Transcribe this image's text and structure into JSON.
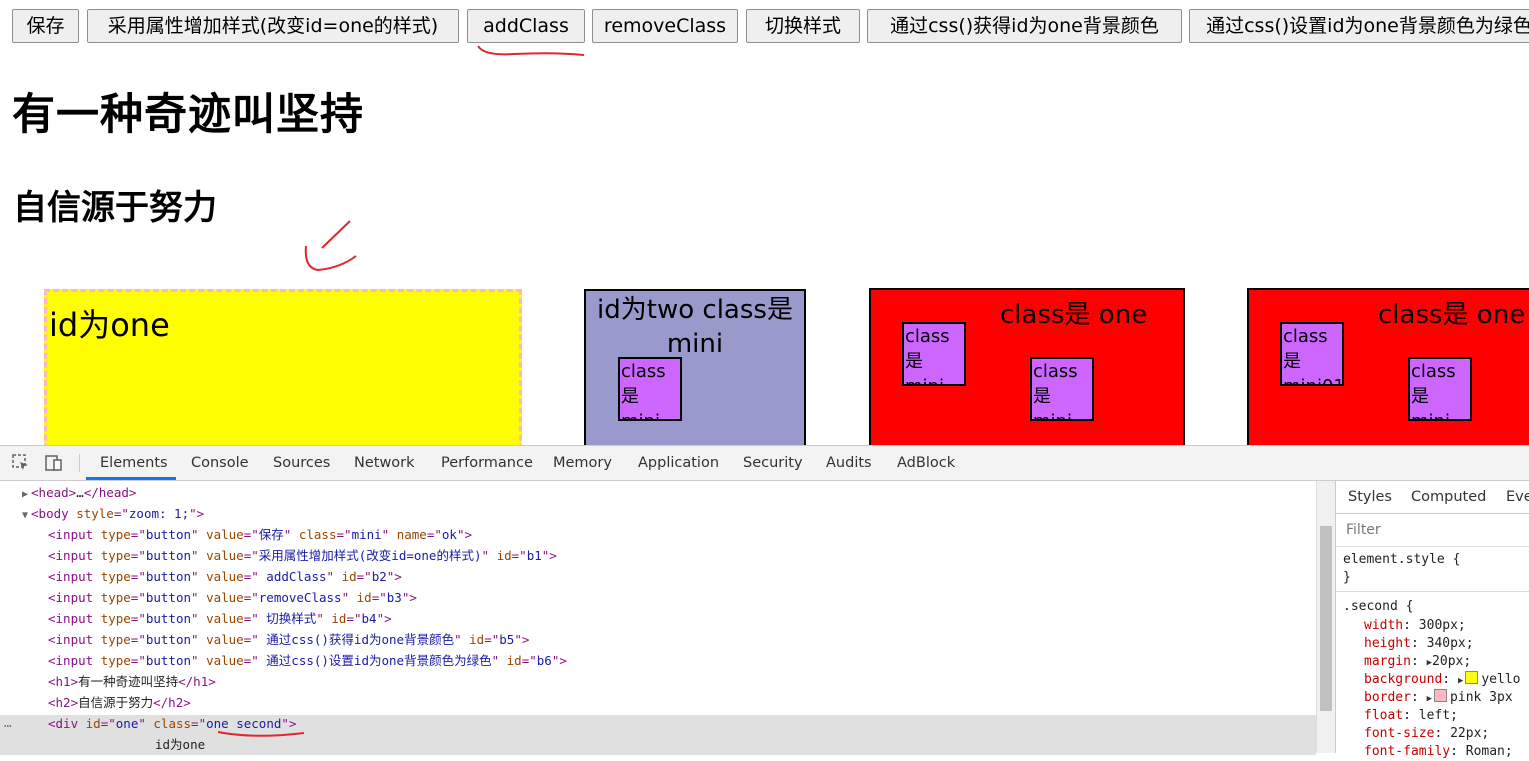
{
  "buttons": [
    {
      "label": "保存"
    },
    {
      "label": "采用属性增加样式(改变id=one的样式)"
    },
    {
      "label": "addClass"
    },
    {
      "label": "removeClass"
    },
    {
      "label": "切换样式"
    },
    {
      "label": "通过css()获得id为one背景颜色"
    },
    {
      "label": "通过css()设置id为one背景颜色为绿色"
    }
  ],
  "headings": {
    "h1": "有一种奇迹叫坚持",
    "h2": "自信源于努力"
  },
  "boxes": {
    "one_label": "id为one",
    "two_label": "id为two class是 mini",
    "two_inner": "class是 mini",
    "red1_label": "class是 one",
    "red1_mini_a": "class是 mini",
    "red1_mini_b": "class是 mini",
    "red2_label": "class是 one",
    "red2_mini_a": "class是 mini01",
    "red2_mini_b": "class是 mini"
  },
  "colors": {
    "yellow": "#ffff00",
    "pink": "#ffb6c1",
    "lavender": "#9999cc",
    "red": "#ff0000",
    "purple": "#cc66ff",
    "annotation": "#e0262f"
  },
  "devtools": {
    "tabs": [
      "Elements",
      "Console",
      "Sources",
      "Network",
      "Performance",
      "Memory",
      "Application",
      "Security",
      "Audits",
      "AdBlock"
    ],
    "active_tab": "Elements",
    "dom_lines": [
      {
        "parts": [
          [
            "tag",
            "<head>"
          ],
          [
            "txt",
            "…"
          ],
          [
            "tag",
            "</head>"
          ]
        ]
      },
      {
        "parts": [
          [
            "tag",
            "<body "
          ],
          [
            "attr",
            "style"
          ],
          [
            "tag",
            "=\""
          ],
          [
            "val",
            "zoom: 1;"
          ],
          [
            "tag",
            "\">"
          ]
        ]
      },
      {
        "parts": [
          [
            "tag",
            "<input "
          ],
          [
            "attr",
            "type"
          ],
          [
            "tag",
            "=\""
          ],
          [
            "val",
            "button"
          ],
          [
            "tag",
            "\" "
          ],
          [
            "attr",
            "value"
          ],
          [
            "tag",
            "=\""
          ],
          [
            "val",
            "保存"
          ],
          [
            "tag",
            "\" "
          ],
          [
            "attr",
            "class"
          ],
          [
            "tag",
            "=\""
          ],
          [
            "val",
            "mini"
          ],
          [
            "tag",
            "\" "
          ],
          [
            "attr",
            "name"
          ],
          [
            "tag",
            "=\""
          ],
          [
            "val",
            "ok"
          ],
          [
            "tag",
            "\">"
          ]
        ]
      },
      {
        "parts": [
          [
            "tag",
            "<input "
          ],
          [
            "attr",
            "type"
          ],
          [
            "tag",
            "=\""
          ],
          [
            "val",
            "button"
          ],
          [
            "tag",
            "\" "
          ],
          [
            "attr",
            "value"
          ],
          [
            "tag",
            "=\""
          ],
          [
            "val",
            "采用属性增加样式(改变id=one的样式)"
          ],
          [
            "tag",
            "\" "
          ],
          [
            "attr",
            "id"
          ],
          [
            "tag",
            "=\""
          ],
          [
            "val",
            "b1"
          ],
          [
            "tag",
            "\">"
          ]
        ]
      },
      {
        "parts": [
          [
            "tag",
            "<input "
          ],
          [
            "attr",
            "type"
          ],
          [
            "tag",
            "=\""
          ],
          [
            "val",
            "button"
          ],
          [
            "tag",
            "\" "
          ],
          [
            "attr",
            "value"
          ],
          [
            "tag",
            "=\""
          ],
          [
            "val",
            " addClass"
          ],
          [
            "tag",
            "\" "
          ],
          [
            "attr",
            "id"
          ],
          [
            "tag",
            "=\""
          ],
          [
            "val",
            "b2"
          ],
          [
            "tag",
            "\">"
          ]
        ]
      },
      {
        "parts": [
          [
            "tag",
            "<input "
          ],
          [
            "attr",
            "type"
          ],
          [
            "tag",
            "=\""
          ],
          [
            "val",
            "button"
          ],
          [
            "tag",
            "\" "
          ],
          [
            "attr",
            "value"
          ],
          [
            "tag",
            "=\""
          ],
          [
            "val",
            "removeClass"
          ],
          [
            "tag",
            "\" "
          ],
          [
            "attr",
            "id"
          ],
          [
            "tag",
            "=\""
          ],
          [
            "val",
            "b3"
          ],
          [
            "tag",
            "\">"
          ]
        ]
      },
      {
        "parts": [
          [
            "tag",
            "<input "
          ],
          [
            "attr",
            "type"
          ],
          [
            "tag",
            "=\""
          ],
          [
            "val",
            "button"
          ],
          [
            "tag",
            "\" "
          ],
          [
            "attr",
            "value"
          ],
          [
            "tag",
            "=\""
          ],
          [
            "val",
            " 切换样式"
          ],
          [
            "tag",
            "\" "
          ],
          [
            "attr",
            "id"
          ],
          [
            "tag",
            "=\""
          ],
          [
            "val",
            "b4"
          ],
          [
            "tag",
            "\">"
          ]
        ]
      },
      {
        "parts": [
          [
            "tag",
            "<input "
          ],
          [
            "attr",
            "type"
          ],
          [
            "tag",
            "=\""
          ],
          [
            "val",
            "button"
          ],
          [
            "tag",
            "\" "
          ],
          [
            "attr",
            "value"
          ],
          [
            "tag",
            "=\""
          ],
          [
            "val",
            " 通过css()获得id为one背景颜色"
          ],
          [
            "tag",
            "\" "
          ],
          [
            "attr",
            "id"
          ],
          [
            "tag",
            "=\""
          ],
          [
            "val",
            "b5"
          ],
          [
            "tag",
            "\">"
          ]
        ]
      },
      {
        "parts": [
          [
            "tag",
            "<input "
          ],
          [
            "attr",
            "type"
          ],
          [
            "tag",
            "=\""
          ],
          [
            "val",
            "button"
          ],
          [
            "tag",
            "\" "
          ],
          [
            "attr",
            "value"
          ],
          [
            "tag",
            "=\""
          ],
          [
            "val",
            " 通过css()设置id为one背景颜色为绿色"
          ],
          [
            "tag",
            "\" "
          ],
          [
            "attr",
            "id"
          ],
          [
            "tag",
            "=\""
          ],
          [
            "val",
            "b6"
          ],
          [
            "tag",
            "\">"
          ]
        ]
      },
      {
        "parts": [
          [
            "tag",
            "<h1>"
          ],
          [
            "txt",
            "有一种奇迹叫坚持"
          ],
          [
            "tag",
            "</h1>"
          ]
        ]
      },
      {
        "parts": [
          [
            "tag",
            "<h2>"
          ],
          [
            "txt",
            "自信源于努力"
          ],
          [
            "tag",
            "</h2>"
          ]
        ]
      },
      {
        "parts": [
          [
            "tag",
            "<div "
          ],
          [
            "attr",
            "id"
          ],
          [
            "tag",
            "=\""
          ],
          [
            "val",
            "one"
          ],
          [
            "tag",
            "\" "
          ],
          [
            "attr",
            "class"
          ],
          [
            "tag",
            "=\""
          ],
          [
            "val",
            "one second"
          ],
          [
            "tag",
            "\">"
          ]
        ]
      },
      {
        "parts": [
          [
            "txt",
            "id为one"
          ]
        ]
      }
    ],
    "ellipsis": "…",
    "styles_tabs": [
      "Styles",
      "Computed",
      "Eve"
    ],
    "filter_placeholder": "Filter",
    "element_style_open": "element.style {",
    "element_style_close": "}",
    "rule_selector": ".second {",
    "declarations": [
      {
        "prop": "width",
        "value": "300px;"
      },
      {
        "prop": "height",
        "value": "340px;"
      },
      {
        "prop": "margin",
        "value": "20px;"
      },
      {
        "prop": "background",
        "value": "yello"
      },
      {
        "prop": "border",
        "value": "pink 3px"
      },
      {
        "prop": "float",
        "value": "left;"
      },
      {
        "prop": "font-size",
        "value": "22px;"
      },
      {
        "prop": "font-family",
        "value": "Roman;"
      }
    ]
  }
}
